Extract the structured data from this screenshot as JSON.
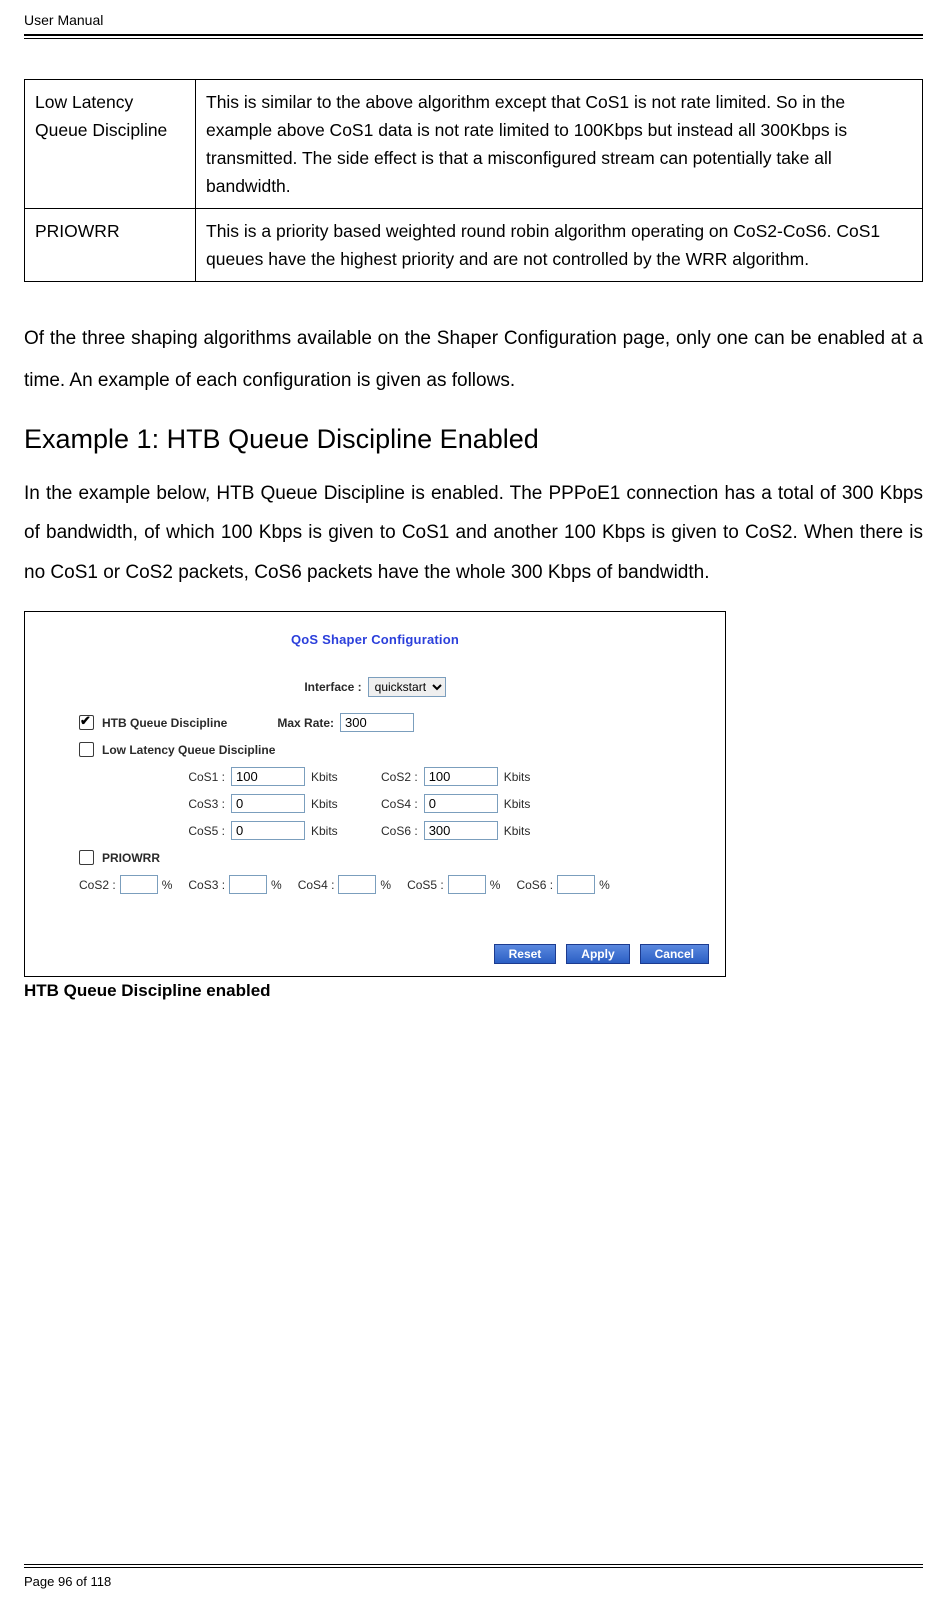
{
  "header": {
    "title": "User Manual"
  },
  "table_rows": [
    {
      "term": "Low Latency Queue Discipline",
      "desc": "This is similar to the above algorithm except that CoS1 is not rate limited. So in the example above CoS1 data is not rate limited to 100Kbps but instead all 300Kbps is transmitted. The side effect is that a misconfigured stream can potentially take all bandwidth."
    },
    {
      "term": "PRIOWRR",
      "desc": "This is a priority based weighted round robin algorithm operating on CoS2-CoS6. CoS1 queues have the highest priority and are not controlled by the WRR algorithm."
    }
  ],
  "para1": "Of the three shaping algorithms available on the Shaper Configuration page, only one can be enabled at a time. An example of each configuration is given as follows.",
  "example_heading": "Example 1: HTB Queue Discipline Enabled",
  "para2": "In the example below, HTB Queue Discipline is enabled. The PPPoE1 connection has a total of 300 Kbps of bandwidth, of which 100 Kbps is given to CoS1 and another 100 Kbps is given to CoS2. When there is no CoS1 or CoS2 packets, CoS6 packets have the whole 300 Kbps of bandwidth.",
  "figure": {
    "title": "QoS Shaper Configuration",
    "interface_label": "Interface :",
    "interface_value": "quickstart",
    "htb_label": "HTB Queue Discipline",
    "htb_checked": true,
    "max_rate_label": "Max Rate:",
    "max_rate_value": "300",
    "lowlat_label": "Low Latency Queue Discipline",
    "lowlat_checked": false,
    "cos_unit": "Kbits",
    "cos_rows": [
      {
        "l1_label": "CoS1 :",
        "l1_val": "100",
        "l2_label": "CoS2 :",
        "l2_val": "100"
      },
      {
        "l1_label": "CoS3 :",
        "l1_val": "0",
        "l2_label": "CoS4 :",
        "l2_val": "0"
      },
      {
        "l1_label": "CoS5 :",
        "l1_val": "0",
        "l2_label": "CoS6 :",
        "l2_val": "300"
      }
    ],
    "priowrr_label": "PRIOWRR",
    "priowrr_checked": false,
    "priowrr_cos": [
      {
        "label": "CoS2 :",
        "val": ""
      },
      {
        "label": "CoS3 :",
        "val": ""
      },
      {
        "label": "CoS4 :",
        "val": ""
      },
      {
        "label": "CoS5 :",
        "val": ""
      },
      {
        "label": "CoS6 :",
        "val": ""
      }
    ],
    "percent": "%",
    "buttons": {
      "reset": "Reset",
      "apply": "Apply",
      "cancel": "Cancel"
    }
  },
  "caption": "HTB Queue Discipline enabled",
  "footer": "Page 96 of 118"
}
